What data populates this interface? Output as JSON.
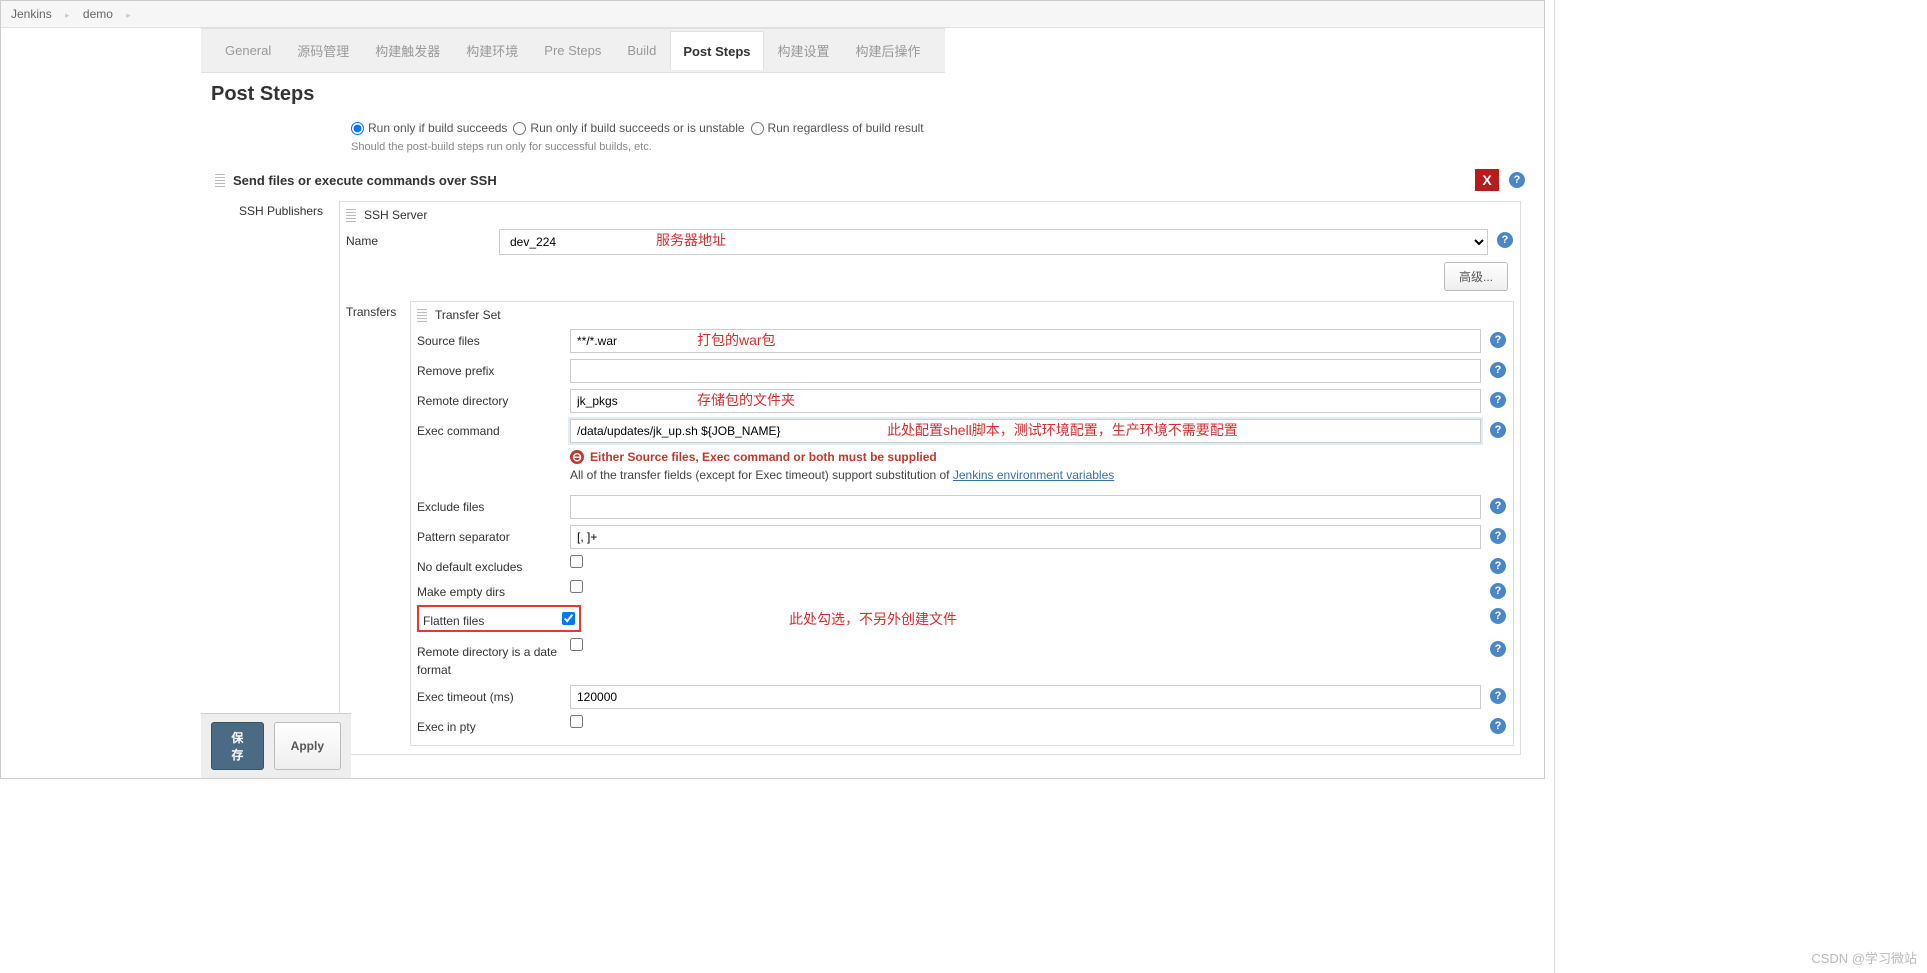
{
  "breadcrumb": {
    "root": "Jenkins",
    "project": "demo"
  },
  "tabs": {
    "general": "General",
    "scm": "源码管理",
    "triggers": "构建触发器",
    "env": "构建环境",
    "presteps": "Pre Steps",
    "build": "Build",
    "poststeps": "Post Steps",
    "buildsettings": "构建设置",
    "postbuild": "构建后操作"
  },
  "section": {
    "title": "Post Steps"
  },
  "runopts": {
    "succeeds": "Run only if build succeeds",
    "unstable": "Run only if build succeeds or is unstable",
    "regardless": "Run regardless of build result",
    "hint": "Should the post-build steps run only for successful builds, etc."
  },
  "step": {
    "header": "Send files or execute commands over SSH",
    "close": "X",
    "publishers_label": "SSH Publishers",
    "server_header": "SSH Server",
    "name_label": "Name",
    "server_selected": "dev_224",
    "advanced": "高级...",
    "transfers_label": "Transfers",
    "transferset_header": "Transfer Set",
    "fields": {
      "source_files": "Source files",
      "source_files_val": "**/*.war",
      "remove_prefix": "Remove prefix",
      "remove_prefix_val": "",
      "remote_dir": "Remote directory",
      "remote_dir_val": "jk_pkgs",
      "exec_cmd": "Exec command",
      "exec_cmd_val": "/data/updates/jk_up.sh ${JOB_NAME}",
      "exclude_files": "Exclude files",
      "exclude_files_val": "",
      "pattern_sep": "Pattern separator",
      "pattern_sep_val": "[, ]+",
      "no_default_excludes": "No default excludes",
      "make_empty_dirs": "Make empty dirs",
      "flatten_files": "Flatten files",
      "remote_dir_date": "Remote directory is a date format",
      "exec_timeout": "Exec timeout (ms)",
      "exec_timeout_val": "120000",
      "exec_in_pty": "Exec in pty"
    },
    "error": "Either Source files, Exec command or both must be supplied",
    "info_prefix": "All of the transfer fields (except for Exec timeout) support substitution of ",
    "info_link": "Jenkins environment variables"
  },
  "annotations": {
    "server": "服务器地址",
    "war": "打包的war包",
    "folder": "存储包的文件夹",
    "shell": "此处配置shell脚本，测试环境配置，生产环境不需要配置",
    "flatten": "此处勾选，不另外创建文件"
  },
  "buttons": {
    "save": "保存",
    "apply": "Apply"
  },
  "watermark": "CSDN @学习微站"
}
